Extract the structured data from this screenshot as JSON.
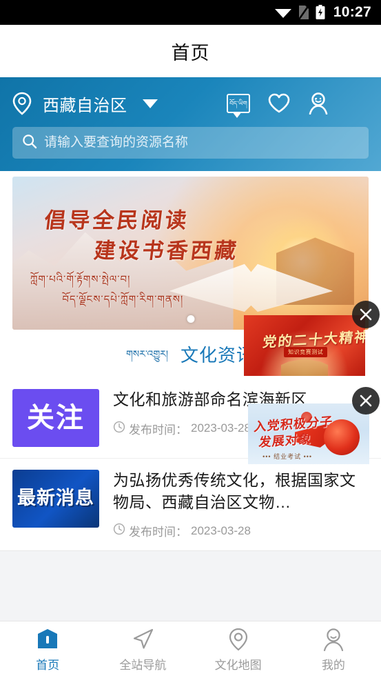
{
  "statusbar": {
    "time": "10:27",
    "wifi_icon": "wifi-icon",
    "sim_icon": "no-sim-icon",
    "battery_icon": "battery-charging-icon"
  },
  "titlebar": {
    "title": "首页"
  },
  "header": {
    "location_icon": "location-pin-icon",
    "location": "西藏自治区",
    "dropdown_icon": "chevron-down-icon",
    "icons": [
      {
        "name": "tibetan-language-icon",
        "label": "བོད་ཡིག"
      },
      {
        "name": "favorites-heart-icon",
        "label": ""
      },
      {
        "name": "user-account-icon",
        "label": ""
      },
      {
        "name": "hamburger-menu-icon",
        "label": ""
      }
    ],
    "search": {
      "icon": "search-icon",
      "value": "",
      "placeholder": "请输入要查询的资源名称"
    }
  },
  "banner": {
    "line1": "倡导全民阅读",
    "line2": "建设书香西藏",
    "tibetan1": "ཀློག་པའི་གོ་རྟོགས་སྤེལ་བ།",
    "tibetan2": "བོད་ལྗོངས་དཔེ་ཀློག་རིག་གནས།",
    "pagination": {
      "current": 1,
      "total": 1
    }
  },
  "section": {
    "tibetan_label": "གསར་འགྱུར།",
    "title": "文化资讯"
  },
  "news": [
    {
      "thumb_text": "关注",
      "thumb_color": "#6b4df0",
      "title": "文化和旅游部命名滨海新区",
      "time_icon": "clock-icon",
      "time_label": "发布时间：",
      "time": "2023-03-28"
    },
    {
      "thumb_text": "最新消息",
      "thumb_color": "#0b3d91",
      "title": "为弘扬优秀传统文化，根据国家文物局、西藏自治区文物…",
      "time_icon": "clock-icon",
      "time_label": "发布时间：",
      "time": "2023-03-28"
    }
  ],
  "ads": [
    {
      "name": "party-congress-ad",
      "title": "党的二十大精神",
      "badge": "知识竞赛测试",
      "close_icon": "close-icon"
    },
    {
      "name": "party-member-ad",
      "title_line1": "入党积极分子",
      "title_line2": "发展对象",
      "subtitle": "••• 结业考试 •••",
      "close_icon": "close-icon"
    }
  ],
  "bottomnav": [
    {
      "icon": "home-icon",
      "label": "首页",
      "active": true
    },
    {
      "icon": "navigation-arrow-icon",
      "label": "全站导航",
      "active": false
    },
    {
      "icon": "map-pin-icon",
      "label": "文化地图",
      "active": false
    },
    {
      "icon": "user-profile-icon",
      "label": "我的",
      "active": false
    }
  ],
  "colors": {
    "accent": "#1878b8",
    "header_blue": "#1074a8",
    "ad_red": "#c21f12",
    "thumb_purple": "#6b4df0"
  }
}
